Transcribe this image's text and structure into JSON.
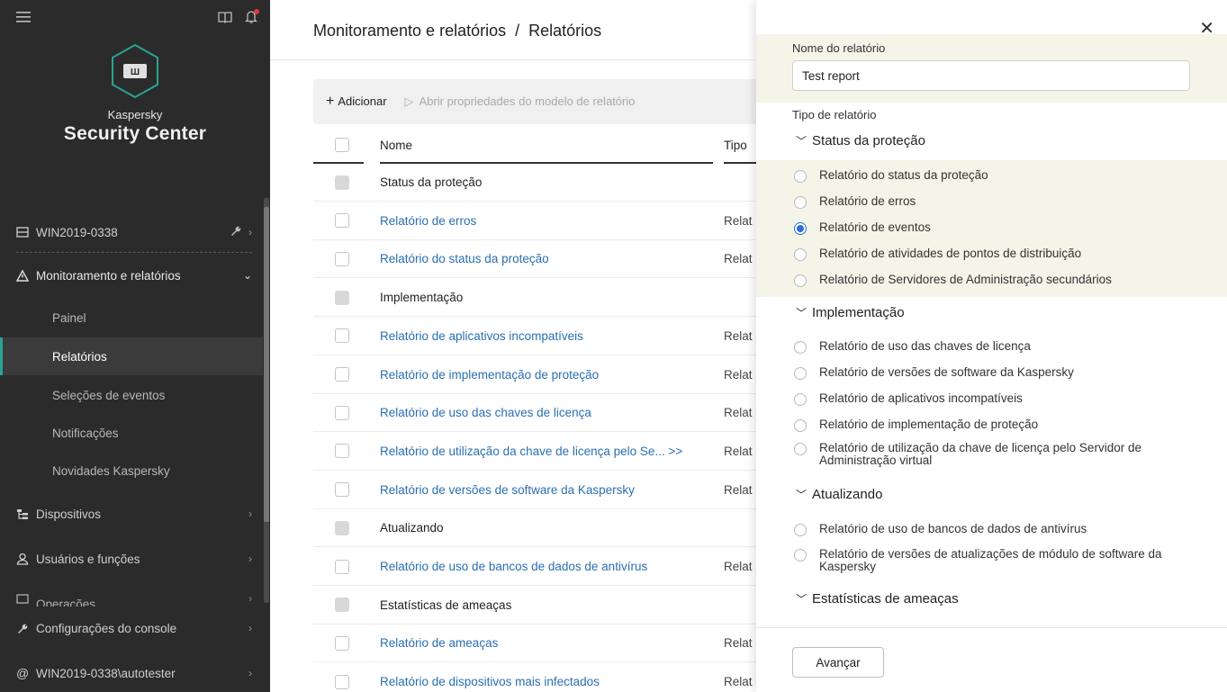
{
  "sidebar": {
    "brand_line1": "Kaspersky",
    "brand_line2": "Security Center",
    "server": "WIN2019-0338",
    "monitoring": "Monitoramento e relatórios",
    "sub_items": [
      "Painel",
      "Relatórios",
      "Seleções de eventos",
      "Notificações",
      "Novidades Kaspersky"
    ],
    "devices": "Dispositivos",
    "users": "Usuários e funções",
    "operations": "Operações",
    "console_settings": "Configurações do console",
    "user_account": "WIN2019-0338\\autotester"
  },
  "main": {
    "breadcrumb": "Monitoramento e relatórios  /  Relatórios",
    "toolbar": {
      "add": "Adicionar",
      "open_props": "Abrir propriedades do modelo de relatório"
    },
    "columns": {
      "name": "Nome",
      "type": "Tipo"
    },
    "rows": [
      {
        "name": "Status da proteção",
        "type": "",
        "group": true
      },
      {
        "name": "Relatório de erros",
        "type": "Relat",
        "group": false
      },
      {
        "name": "Relatório do status da proteção",
        "type": "Relat",
        "group": false
      },
      {
        "name": "Implementação",
        "type": "",
        "group": true
      },
      {
        "name": "Relatório de aplicativos incompatíveis",
        "type": "Relat",
        "group": false
      },
      {
        "name": "Relatório de implementação de proteção",
        "type": "Relat",
        "group": false
      },
      {
        "name": "Relatório de uso das chaves de licença",
        "type": "Relat",
        "group": false
      },
      {
        "name": "Relatório de utilização da chave de licença pelo Se... >>",
        "type": "Relat",
        "group": false
      },
      {
        "name": "Relatório de versões de software da Kaspersky",
        "type": "Relat",
        "group": false
      },
      {
        "name": "Atualizando",
        "type": "",
        "group": true
      },
      {
        "name": "Relatório de uso de bancos de dados de antivírus",
        "type": "Relat",
        "group": false
      },
      {
        "name": "Estatísticas de ameaças",
        "type": "",
        "group": true
      },
      {
        "name": "Relatório de ameaças",
        "type": "Relat",
        "group": false
      },
      {
        "name": "Relatório de dispositivos mais infectados",
        "type": "Relat",
        "group": false
      }
    ]
  },
  "drawer": {
    "report_name_label": "Nome do relatório",
    "report_name_value": "Test report",
    "report_type_label": "Tipo de relatório",
    "groups": [
      {
        "title": "Status da proteção",
        "options": [
          {
            "label": "Relatório do status da proteção",
            "selected": false
          },
          {
            "label": "Relatório de erros",
            "selected": false
          },
          {
            "label": "Relatório de eventos",
            "selected": true
          },
          {
            "label": "Relatório de atividades de pontos de distribuição",
            "selected": false
          },
          {
            "label": "Relatório de Servidores de Administração secundários",
            "selected": false
          }
        ]
      },
      {
        "title": "Implementação",
        "options": [
          {
            "label": "Relatório de uso das chaves de licença",
            "selected": false
          },
          {
            "label": "Relatório de versões de software da Kaspersky",
            "selected": false
          },
          {
            "label": "Relatório de aplicativos incompatíveis",
            "selected": false
          },
          {
            "label": "Relatório de implementação de proteção",
            "selected": false
          },
          {
            "label": "Relatório de utilização da chave de licença pelo Servidor de Administração virtual",
            "selected": false
          }
        ]
      },
      {
        "title": "Atualizando",
        "options": [
          {
            "label": "Relatório de uso de bancos de dados de antivírus",
            "selected": false
          },
          {
            "label": "Relatório de versões de atualizações de módulo de software da Kaspersky",
            "selected": false
          }
        ]
      },
      {
        "title": "Estatísticas de ameaças",
        "options": []
      }
    ],
    "next_button": "Avançar"
  },
  "colors": {
    "sidebar_bg": "#2b2b2b",
    "accent": "#2aa394",
    "link": "#2a6fb1",
    "highlight": "#f5f4e8",
    "radio_selected": "#2b6ed9"
  }
}
